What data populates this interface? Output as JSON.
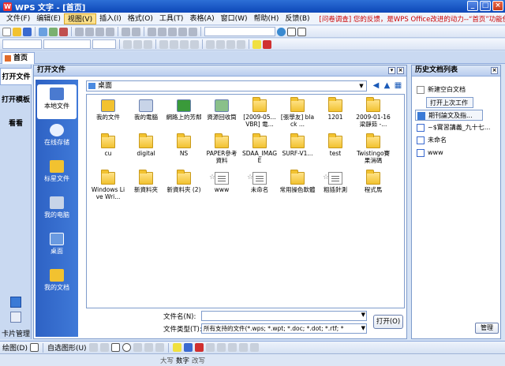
{
  "window": {
    "title": "WPS 文字 - [首页]"
  },
  "menu": {
    "items": [
      "文件(F)",
      "编辑(E)",
      "视图(V)",
      "插入(I)",
      "格式(O)",
      "工具(T)",
      "表格(A)",
      "窗口(W)",
      "帮助(H)"
    ],
    "feedback_label": "反馈(B)",
    "notice": "[问卷调查] 您的反馈，是WPS Office改进的动力--“首页”功能使用调查"
  },
  "tabs": {
    "home": "首页"
  },
  "left_nav": {
    "tabs": [
      "打开文件",
      "打开模板",
      "看看"
    ],
    "card_manager": "卡片管理"
  },
  "open_panel": {
    "title": "打开文件",
    "places": [
      "本地文件",
      "在线存储",
      "标星文件",
      "我的电脑",
      "桌面",
      "我的文档"
    ],
    "address": "桌面",
    "files": [
      {
        "name": "我的文件",
        "kind": "special"
      },
      {
        "name": "我的電腦",
        "kind": "computer"
      },
      {
        "name": "網路上的芳鄰",
        "kind": "network"
      },
      {
        "name": "資源回收筒",
        "kind": "recycle"
      },
      {
        "name": "[2009-05... VBR] 電...",
        "kind": "folder"
      },
      {
        "name": "[張學友] black ...",
        "kind": "folder"
      },
      {
        "name": "1201",
        "kind": "folder"
      },
      {
        "name": "2009-01-16 梁靜茹 -...",
        "kind": "folder"
      },
      {
        "name": "cu",
        "kind": "folder"
      },
      {
        "name": "digital",
        "kind": "folder"
      },
      {
        "name": "NS",
        "kind": "folder"
      },
      {
        "name": "PAPER參考資料",
        "kind": "folder"
      },
      {
        "name": "SDAA_IMAGE",
        "kind": "folder"
      },
      {
        "name": "SURF-V1...",
        "kind": "folder"
      },
      {
        "name": "test",
        "kind": "folder"
      },
      {
        "name": "Twistingo賽果消碼",
        "kind": "folder"
      },
      {
        "name": "Windows Live Wri...",
        "kind": "folder"
      },
      {
        "name": "新資料夾",
        "kind": "folder"
      },
      {
        "name": "新資料夾 (2)",
        "kind": "folder"
      },
      {
        "name": "www",
        "kind": "doc"
      },
      {
        "name": "未命名",
        "kind": "doc"
      },
      {
        "name": "常用操色軟體",
        "kind": "folder"
      },
      {
        "name": "粗插針測",
        "kind": "doc"
      },
      {
        "name": "程式馬",
        "kind": "folder"
      }
    ],
    "filename_label": "文件名(N):",
    "filename_value": "",
    "filetype_label": "文件类型(T):",
    "filetype_value": "所有支持的文件(*.wps; *.wpt; *.doc; *.dot; *.rtf; *",
    "open_button": "打开(O)"
  },
  "history": {
    "title": "历史文档列表",
    "items": [
      "新建空白文档",
      "打开上次工作",
      "期刊論文及指...",
      "~$實習講義_九十七...",
      "未命名",
      "www"
    ],
    "manage_button": "管理"
  },
  "draw_toolbar": {
    "draw": "绘图(D)",
    "autoshapes": "自选图形(U)"
  },
  "status": {
    "caps": "大写",
    "num": "数字",
    "overwrite": "改写"
  }
}
